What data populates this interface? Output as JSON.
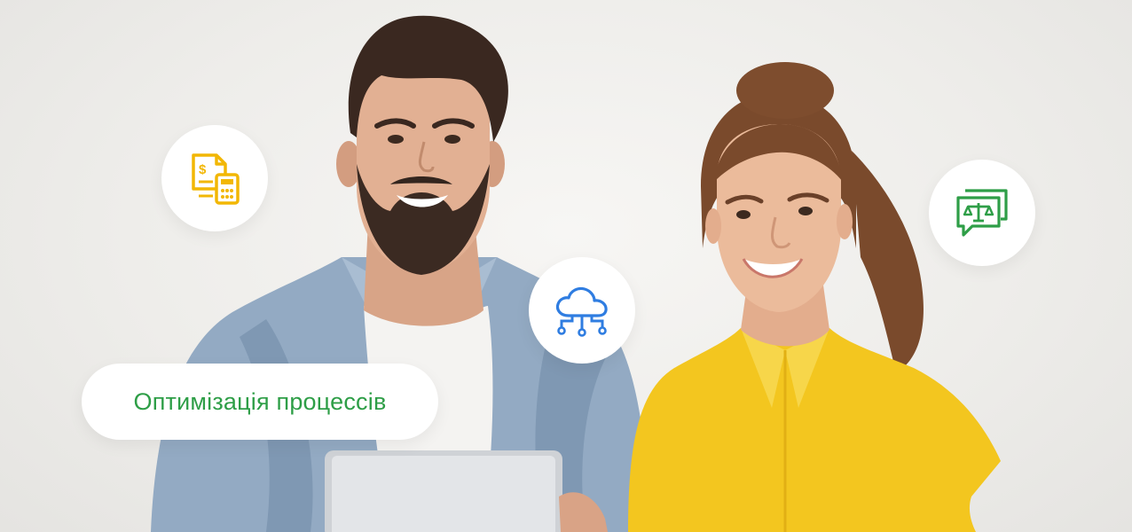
{
  "badge": {
    "label": "Оптимізація процессів"
  },
  "icons": {
    "accounting": "accounting-calculator-icon",
    "cloud": "cloud-network-icon",
    "legal": "legal-scales-chat-icon"
  },
  "colors": {
    "green": "#2e9e47",
    "amber": "#f2b705",
    "blue": "#2f7de1",
    "shirt_yellow": "#f3c61f",
    "denim": "#8fa7c1"
  }
}
